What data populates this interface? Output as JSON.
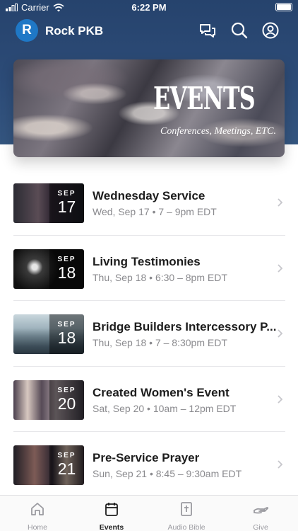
{
  "status_bar": {
    "carrier": "Carrier",
    "time": "6:22 PM"
  },
  "header": {
    "logo_letter": "R",
    "app_title": "Rock PKB",
    "icons": [
      "chat-icon",
      "search-icon",
      "account-icon"
    ]
  },
  "banner": {
    "title": "EVENTS",
    "subtitle": "Conferences, Meetings, ETC."
  },
  "events": [
    {
      "title": "Wednesday Service",
      "when": "Wed, Sep 17 • 7 – 9pm EDT",
      "month": "SEP",
      "day": "17"
    },
    {
      "title": "Living Testimonies",
      "when": "Thu, Sep 18 • 6:30 – 8pm EDT",
      "month": "SEP",
      "day": "18"
    },
    {
      "title": "Bridge Builders Intercessory P...",
      "when": "Thu, Sep 18 • 7 – 8:30pm EDT",
      "month": "SEP",
      "day": "18"
    },
    {
      "title": "Created Women's Event",
      "when": "Sat, Sep 20 • 10am – 12pm EDT",
      "month": "SEP",
      "day": "20"
    },
    {
      "title": "Pre-Service Prayer",
      "when": "Sun, Sep 21 • 8:45 – 9:30am EDT",
      "month": "SEP",
      "day": "21"
    }
  ],
  "tab_bar": {
    "tabs": [
      {
        "label": "Home",
        "icon": "home-icon"
      },
      {
        "label": "Events",
        "icon": "calendar-icon",
        "active": true
      },
      {
        "label": "Audio Bible",
        "icon": "bible-icon"
      },
      {
        "label": "Give",
        "icon": "give-hand-icon"
      }
    ]
  },
  "colors": {
    "header_blue": "#2d4c78",
    "logo_blue": "#1f78c6"
  }
}
